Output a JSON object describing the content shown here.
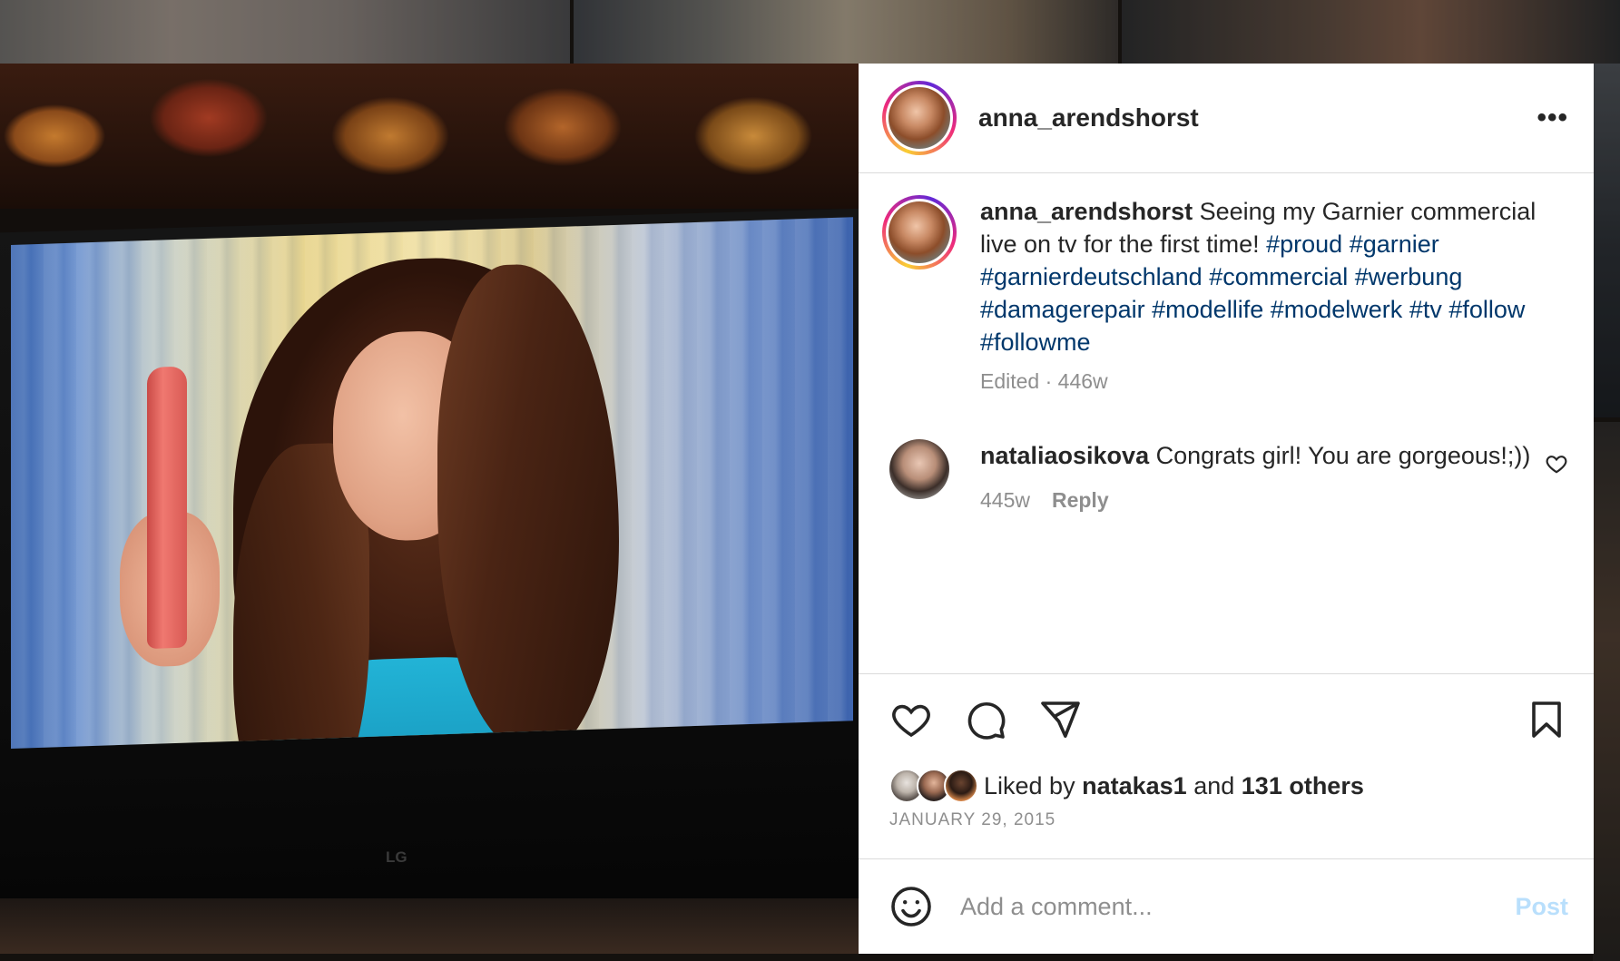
{
  "post": {
    "author": "anna_arendshorst",
    "caption": {
      "username": "anna_arendshorst",
      "text": "Seeing my Garnier commercial live on tv for the first time!",
      "hashtags": [
        "#proud",
        "#garnier",
        "#garnierdeutschland",
        "#commercial",
        "#werbung",
        "#damagerepair",
        "#modellife",
        "#modelwerk",
        "#tv",
        "#follow",
        "#followme"
      ],
      "meta": "Edited · 446w"
    },
    "comments": [
      {
        "username": "nataliaosikova",
        "text": "Congrats girl! You are gorgeous!;))",
        "age": "445w",
        "reply_label": "Reply"
      }
    ],
    "likes": {
      "prefix": "Liked by",
      "user": "natakas1",
      "conjunction": "and",
      "others": "131 others"
    },
    "date": "JANUARY 29, 2015",
    "photo": {
      "tv_brand": "LG"
    }
  },
  "comment_box": {
    "placeholder": "Add a comment...",
    "post_label": "Post"
  },
  "icons": {
    "more": "more-options-icon",
    "like": "heart-icon",
    "comment": "comment-icon",
    "share": "share-icon",
    "save": "bookmark-icon",
    "emoji": "emoji-icon"
  },
  "colors": {
    "link": "#00376b",
    "secondary_text": "#8e8e8e",
    "post_disabled": "#b9dffc"
  }
}
